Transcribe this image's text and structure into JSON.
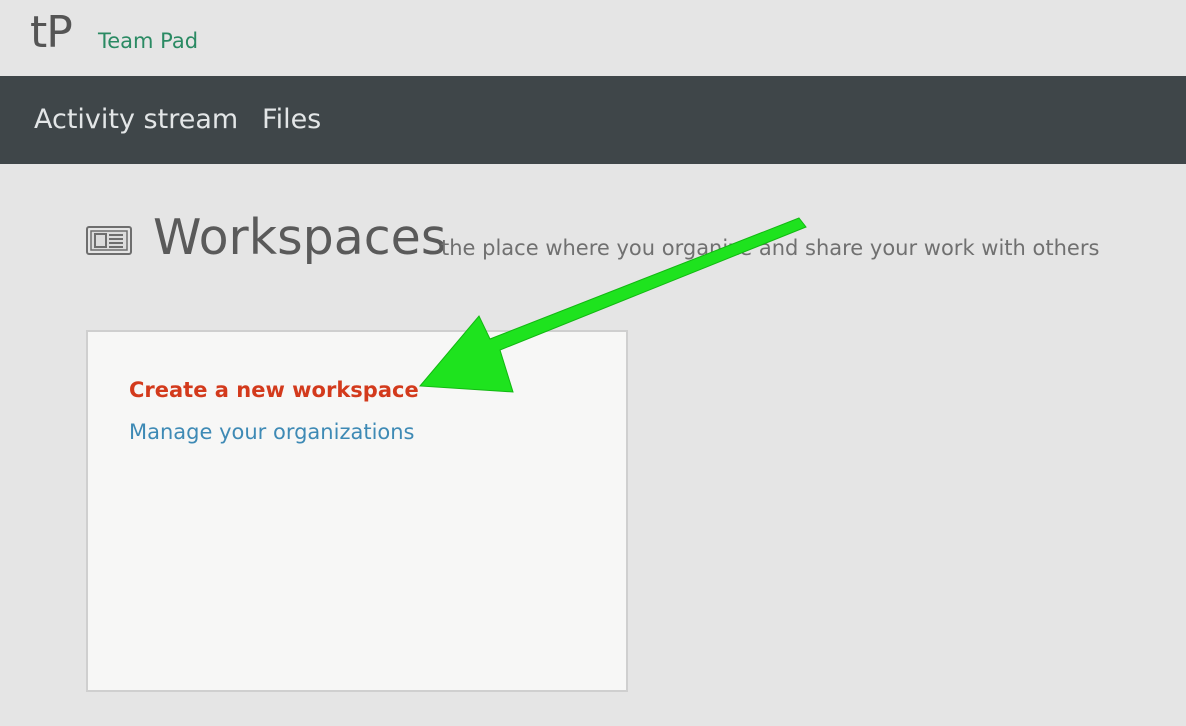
{
  "header": {
    "logo_text": "tP",
    "brand_name": "Team Pad"
  },
  "nav": {
    "items": [
      {
        "label": "Activity stream"
      },
      {
        "label": "Files"
      }
    ]
  },
  "main": {
    "title_icon": "newspaper-icon",
    "title": "Workspaces",
    "subtitle": "the place where you organize and share your work with others",
    "card": {
      "links": [
        {
          "label": "Create a new workspace",
          "color": "#d33a1c"
        },
        {
          "label": "Manage your organizations",
          "color": "#3e8ab5"
        }
      ]
    }
  },
  "annotation": {
    "icon": "green-arrow-icon",
    "color": "#1ee31e"
  },
  "colors": {
    "background": "#e5e5e5",
    "nav_background": "#3f4649",
    "brand": "#2a8a63"
  }
}
